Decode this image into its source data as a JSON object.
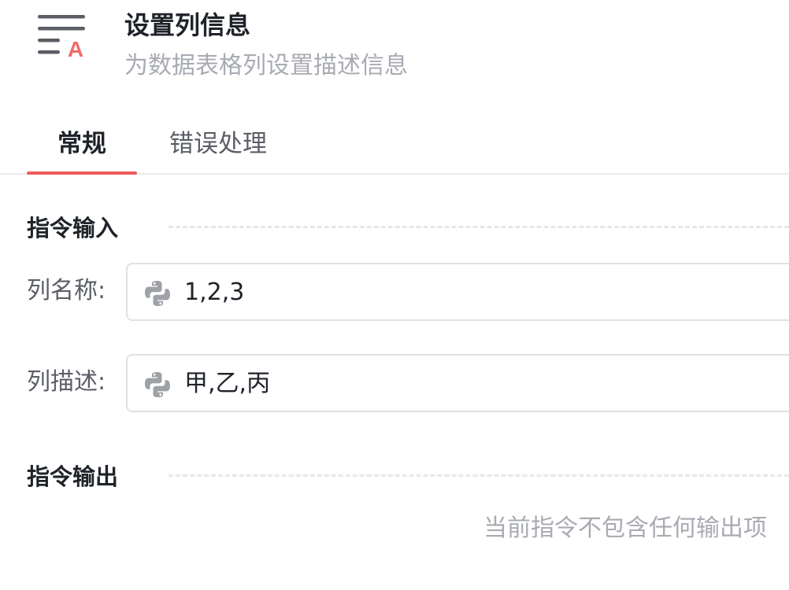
{
  "header": {
    "title": "设置列信息",
    "subtitle": "为数据表格列设置描述信息",
    "icon": "column-text-icon",
    "icon_letter": "A",
    "icon_accent_color": "#f06a6a"
  },
  "tabs": [
    {
      "label": "常规",
      "active": true
    },
    {
      "label": "错误处理",
      "active": false
    }
  ],
  "input_section": {
    "title": "指令输入",
    "fields": [
      {
        "label": "列名称:",
        "value": "1,2,3",
        "icon": "python-icon"
      },
      {
        "label": "列描述:",
        "value": "甲,乙,丙",
        "icon": "python-icon"
      }
    ]
  },
  "output_section": {
    "title": "指令输出",
    "empty_text": "当前指令不包含任何输出项"
  },
  "colors": {
    "accent": "#f05a5a",
    "muted_text": "#a8abb2",
    "border": "#dfe1e5"
  }
}
